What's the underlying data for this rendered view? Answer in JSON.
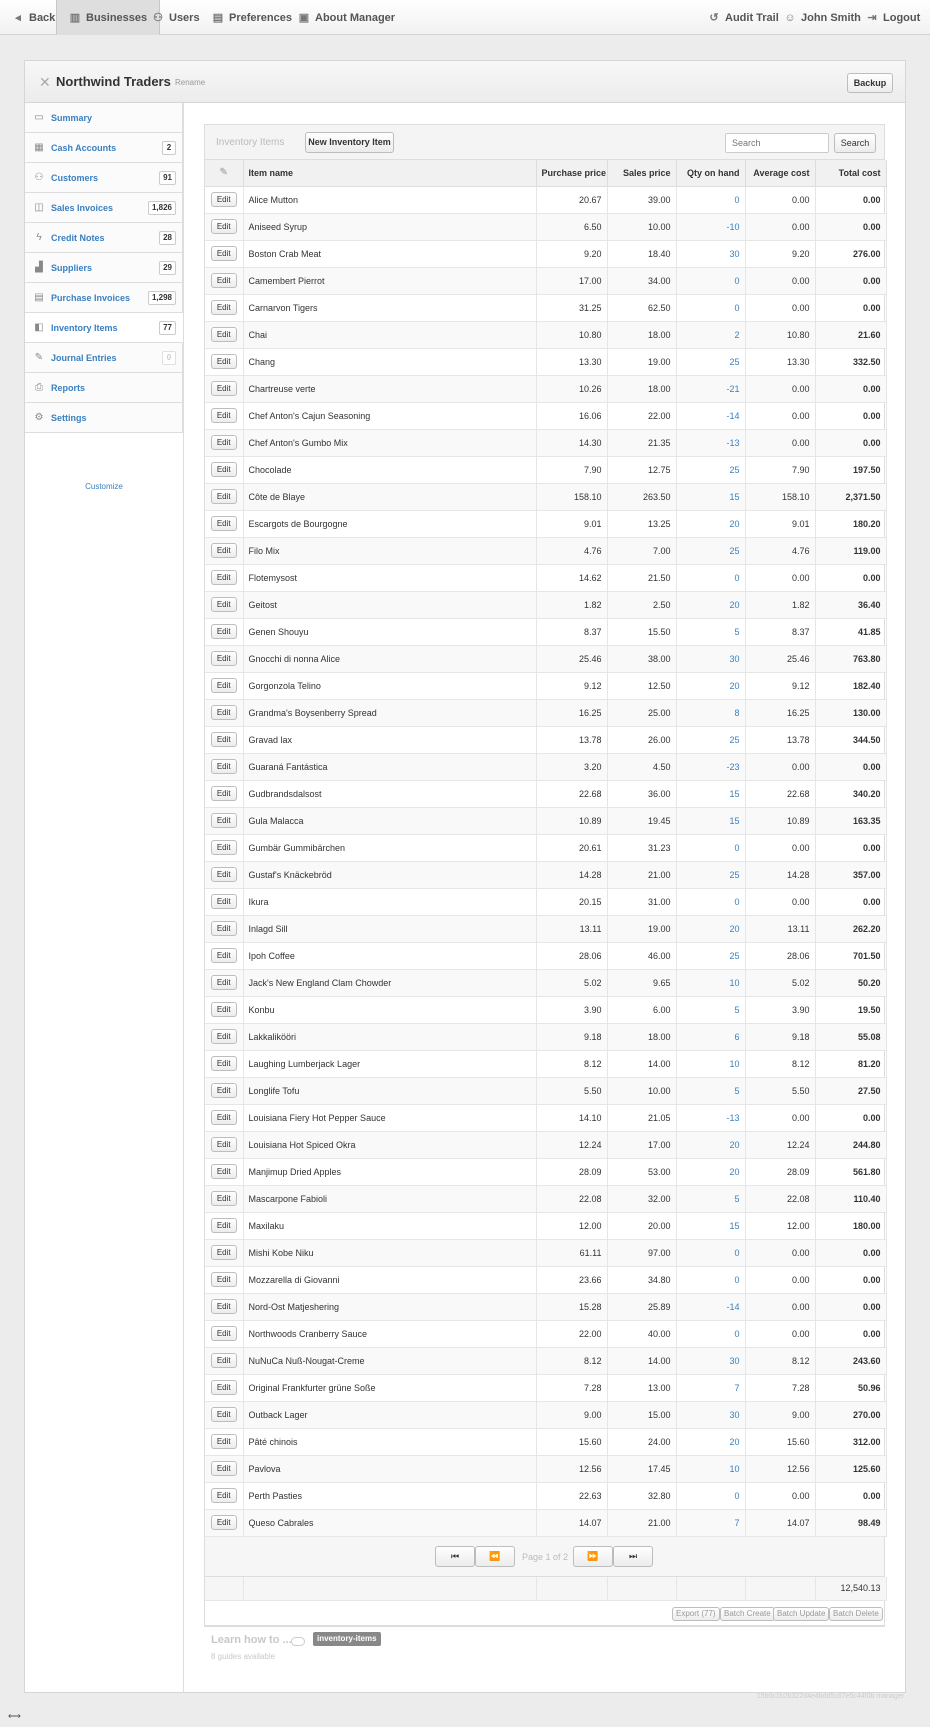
{
  "topbar": {
    "back": "Back",
    "businesses": "Businesses",
    "users": "Users",
    "preferences": "Preferences",
    "about": "About Manager",
    "audit_trail": "Audit Trail",
    "user_name": "John Smith",
    "logout": "Logout"
  },
  "business": {
    "name": "Northwind Traders",
    "rename": "Rename",
    "backup": "Backup"
  },
  "sidebar": {
    "items": [
      {
        "label": "Summary",
        "icon": "monitor-icon",
        "count": ""
      },
      {
        "label": "Cash Accounts",
        "icon": "cash-icon",
        "count": "2"
      },
      {
        "label": "Customers",
        "icon": "people-icon",
        "count": "91"
      },
      {
        "label": "Sales Invoices",
        "icon": "inbox-icon",
        "count": "1,826"
      },
      {
        "label": "Credit Notes",
        "icon": "bolt-icon",
        "count": "28"
      },
      {
        "label": "Suppliers",
        "icon": "factory-icon",
        "count": "29"
      },
      {
        "label": "Purchase Invoices",
        "icon": "calendar-icon",
        "count": "1,298"
      },
      {
        "label": "Inventory Items",
        "icon": "box-icon",
        "count": "77"
      },
      {
        "label": "Journal Entries",
        "icon": "quill-icon",
        "count": "0"
      },
      {
        "label": "Reports",
        "icon": "printer-icon",
        "count": ""
      },
      {
        "label": "Settings",
        "icon": "gears-icon",
        "count": ""
      }
    ],
    "customize": "Customize"
  },
  "inventory": {
    "title": "Inventory Items",
    "new_button": "New Inventory Item",
    "search_placeholder": "Search",
    "search_button": "Search",
    "columns": [
      "Item name",
      "Purchase price",
      "Sales price",
      "Qty on hand",
      "Average cost",
      "Total cost"
    ],
    "edit_label": "Edit",
    "rows": [
      [
        "Alice Mutton",
        "20.67",
        "39.00",
        "0",
        "0.00",
        "0.00"
      ],
      [
        "Aniseed Syrup",
        "6.50",
        "10.00",
        "-10",
        "0.00",
        "0.00"
      ],
      [
        "Boston Crab Meat",
        "9.20",
        "18.40",
        "30",
        "9.20",
        "276.00"
      ],
      [
        "Camembert Pierrot",
        "17.00",
        "34.00",
        "0",
        "0.00",
        "0.00"
      ],
      [
        "Carnarvon Tigers",
        "31.25",
        "62.50",
        "0",
        "0.00",
        "0.00"
      ],
      [
        "Chai",
        "10.80",
        "18.00",
        "2",
        "10.80",
        "21.60"
      ],
      [
        "Chang",
        "13.30",
        "19.00",
        "25",
        "13.30",
        "332.50"
      ],
      [
        "Chartreuse verte",
        "10.26",
        "18.00",
        "-21",
        "0.00",
        "0.00"
      ],
      [
        "Chef Anton's Cajun Seasoning",
        "16.06",
        "22.00",
        "-14",
        "0.00",
        "0.00"
      ],
      [
        "Chef Anton's Gumbo Mix",
        "14.30",
        "21.35",
        "-13",
        "0.00",
        "0.00"
      ],
      [
        "Chocolade",
        "7.90",
        "12.75",
        "25",
        "7.90",
        "197.50"
      ],
      [
        "Côte de Blaye",
        "158.10",
        "263.50",
        "15",
        "158.10",
        "2,371.50"
      ],
      [
        "Escargots de Bourgogne",
        "9.01",
        "13.25",
        "20",
        "9.01",
        "180.20"
      ],
      [
        "Filo Mix",
        "4.76",
        "7.00",
        "25",
        "4.76",
        "119.00"
      ],
      [
        "Flotemysost",
        "14.62",
        "21.50",
        "0",
        "0.00",
        "0.00"
      ],
      [
        "Geitost",
        "1.82",
        "2.50",
        "20",
        "1.82",
        "36.40"
      ],
      [
        "Genen Shouyu",
        "8.37",
        "15.50",
        "5",
        "8.37",
        "41.85"
      ],
      [
        "Gnocchi di nonna Alice",
        "25.46",
        "38.00",
        "30",
        "25.46",
        "763.80"
      ],
      [
        "Gorgonzola Telino",
        "9.12",
        "12.50",
        "20",
        "9.12",
        "182.40"
      ],
      [
        "Grandma's Boysenberry Spread",
        "16.25",
        "25.00",
        "8",
        "16.25",
        "130.00"
      ],
      [
        "Gravad lax",
        "13.78",
        "26.00",
        "25",
        "13.78",
        "344.50"
      ],
      [
        "Guaraná Fantástica",
        "3.20",
        "4.50",
        "-23",
        "0.00",
        "0.00"
      ],
      [
        "Gudbrandsdalsost",
        "22.68",
        "36.00",
        "15",
        "22.68",
        "340.20"
      ],
      [
        "Gula Malacca",
        "10.89",
        "19.45",
        "15",
        "10.89",
        "163.35"
      ],
      [
        "Gumbär Gummibärchen",
        "20.61",
        "31.23",
        "0",
        "0.00",
        "0.00"
      ],
      [
        "Gustaf's Knäckebröd",
        "14.28",
        "21.00",
        "25",
        "14.28",
        "357.00"
      ],
      [
        "Ikura",
        "20.15",
        "31.00",
        "0",
        "0.00",
        "0.00"
      ],
      [
        "Inlagd Sill",
        "13.11",
        "19.00",
        "20",
        "13.11",
        "262.20"
      ],
      [
        "Ipoh Coffee",
        "28.06",
        "46.00",
        "25",
        "28.06",
        "701.50"
      ],
      [
        "Jack's New England Clam Chowder",
        "5.02",
        "9.65",
        "10",
        "5.02",
        "50.20"
      ],
      [
        "Konbu",
        "3.90",
        "6.00",
        "5",
        "3.90",
        "19.50"
      ],
      [
        "Lakkalikööri",
        "9.18",
        "18.00",
        "6",
        "9.18",
        "55.08"
      ],
      [
        "Laughing Lumberjack Lager",
        "8.12",
        "14.00",
        "10",
        "8.12",
        "81.20"
      ],
      [
        "Longlife Tofu",
        "5.50",
        "10.00",
        "5",
        "5.50",
        "27.50"
      ],
      [
        "Louisiana Fiery Hot Pepper Sauce",
        "14.10",
        "21.05",
        "-13",
        "0.00",
        "0.00"
      ],
      [
        "Louisiana Hot Spiced Okra",
        "12.24",
        "17.00",
        "20",
        "12.24",
        "244.80"
      ],
      [
        "Manjimup Dried Apples",
        "28.09",
        "53.00",
        "20",
        "28.09",
        "561.80"
      ],
      [
        "Mascarpone Fabioli",
        "22.08",
        "32.00",
        "5",
        "22.08",
        "110.40"
      ],
      [
        "Maxilaku",
        "12.00",
        "20.00",
        "15",
        "12.00",
        "180.00"
      ],
      [
        "Mishi Kobe Niku",
        "61.11",
        "97.00",
        "0",
        "0.00",
        "0.00"
      ],
      [
        "Mozzarella di Giovanni",
        "23.66",
        "34.80",
        "0",
        "0.00",
        "0.00"
      ],
      [
        "Nord-Ost Matjeshering",
        "15.28",
        "25.89",
        "-14",
        "0.00",
        "0.00"
      ],
      [
        "Northwoods Cranberry Sauce",
        "22.00",
        "40.00",
        "0",
        "0.00",
        "0.00"
      ],
      [
        "NuNuCa Nuß-Nougat-Creme",
        "8.12",
        "14.00",
        "30",
        "8.12",
        "243.60"
      ],
      [
        "Original Frankfurter grüne Soße",
        "7.28",
        "13.00",
        "7",
        "7.28",
        "50.96"
      ],
      [
        "Outback Lager",
        "9.00",
        "15.00",
        "30",
        "9.00",
        "270.00"
      ],
      [
        "Pâté chinois",
        "15.60",
        "24.00",
        "20",
        "15.60",
        "312.00"
      ],
      [
        "Pavlova",
        "12.56",
        "17.45",
        "10",
        "12.56",
        "125.60"
      ],
      [
        "Perth Pasties",
        "22.63",
        "32.80",
        "0",
        "0.00",
        "0.00"
      ],
      [
        "Queso Cabrales",
        "14.07",
        "21.00",
        "7",
        "14.07",
        "98.49"
      ]
    ],
    "page_info": "Page 1 of 2",
    "grand_total": "12,540.13",
    "batch": {
      "export": "Export (77)",
      "create": "Batch Create",
      "update": "Batch Update",
      "delete": "Batch Delete"
    }
  },
  "learn": {
    "title": "Learn how to ...",
    "tag": "inventory-items",
    "subtitle": "8 guides available"
  },
  "footer_id": "15b0c1b2b322d4e4bdd5c67e5c44f0b manager"
}
